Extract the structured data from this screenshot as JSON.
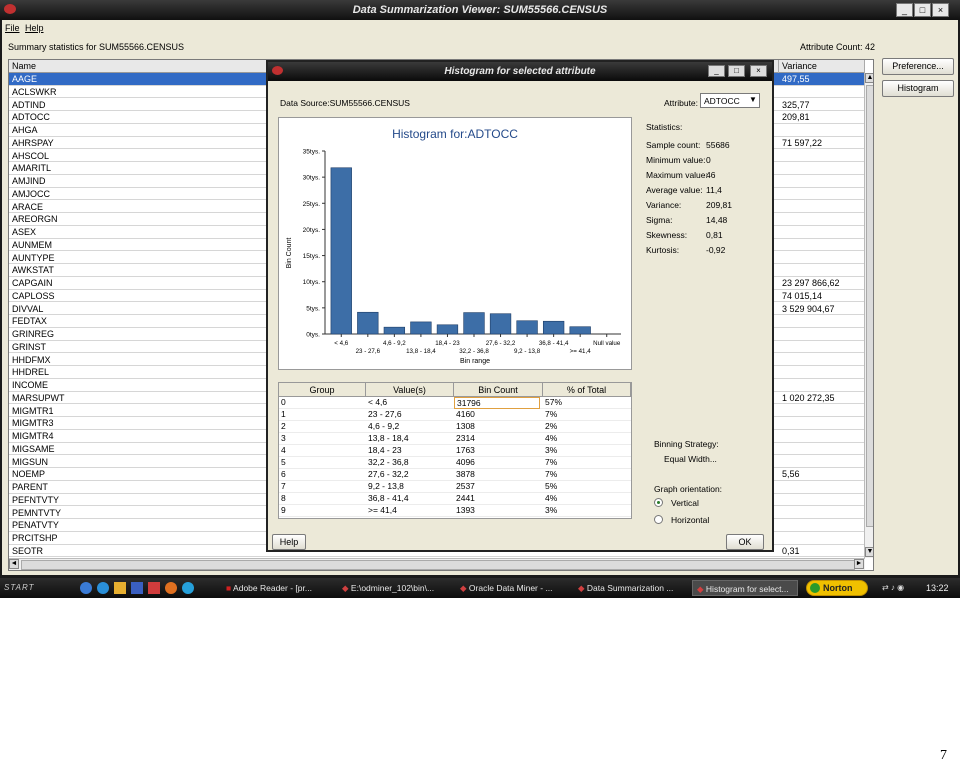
{
  "window": {
    "title": "Data Summarization Viewer: SUM55566.CENSUS",
    "menu": [
      "File",
      "Help"
    ],
    "summary_label": "Summary statistics for SUM55566.CENSUS",
    "attribute_count": "Attribute Count: 42",
    "buttons": {
      "preference": "Preference...",
      "histogram": "Histogram"
    }
  },
  "table": {
    "col_name": "Name",
    "col_variance": "Variance",
    "rows": [
      {
        "name": "AAGE",
        "variance": "497,55",
        "selected": true
      },
      {
        "name": "ACLSWKR",
        "variance": ""
      },
      {
        "name": "ADTIND",
        "variance": "325,77"
      },
      {
        "name": "ADTOCC",
        "variance": "209,81"
      },
      {
        "name": "AHGA",
        "variance": ""
      },
      {
        "name": "AHRSPAY",
        "variance": "71 597,22"
      },
      {
        "name": "AHSCOL",
        "variance": ""
      },
      {
        "name": "AMARITL",
        "variance": ""
      },
      {
        "name": "AMJIND",
        "variance": ""
      },
      {
        "name": "AMJOCC",
        "variance": ""
      },
      {
        "name": "ARACE",
        "variance": ""
      },
      {
        "name": "AREORGN",
        "variance": ""
      },
      {
        "name": "ASEX",
        "variance": ""
      },
      {
        "name": "AUNMEM",
        "variance": ""
      },
      {
        "name": "AUNTYPE",
        "variance": ""
      },
      {
        "name": "AWKSTAT",
        "variance": ""
      },
      {
        "name": "CAPGAIN",
        "variance": "23 297 866,62"
      },
      {
        "name": "CAPLOSS",
        "variance": "74 015,14"
      },
      {
        "name": "DIVVAL",
        "variance": "3 529 904,67"
      },
      {
        "name": "FEDTAX",
        "variance": ""
      },
      {
        "name": "GRINREG",
        "variance": ""
      },
      {
        "name": "GRINST",
        "variance": ""
      },
      {
        "name": "HHDFMX",
        "variance": ""
      },
      {
        "name": "HHDREL",
        "variance": ""
      },
      {
        "name": "INCOME",
        "variance": ""
      },
      {
        "name": "MARSUPWT",
        "variance": "1 020 272,35"
      },
      {
        "name": "MIGMTR1",
        "variance": ""
      },
      {
        "name": "MIGMTR3",
        "variance": ""
      },
      {
        "name": "MIGMTR4",
        "variance": ""
      },
      {
        "name": "MIGSAME",
        "variance": ""
      },
      {
        "name": "MIGSUN",
        "variance": ""
      },
      {
        "name": "NOEMP",
        "variance": "5,56"
      },
      {
        "name": "PARENT",
        "variance": ""
      },
      {
        "name": "PEFNTVTY",
        "variance": ""
      },
      {
        "name": "PEMNTVTY",
        "variance": ""
      },
      {
        "name": "PENATVTY",
        "variance": ""
      },
      {
        "name": "PRCITSHP",
        "variance": ""
      },
      {
        "name": "SEOTR",
        "variance": "0,31"
      }
    ]
  },
  "dialog": {
    "title": "Histogram for selected attribute",
    "data_source": "Data Source:SUM55566.CENSUS",
    "attribute_label": "Attribute:",
    "attribute_value": "ADTOCC",
    "statistics_title": "Statistics:",
    "stats": [
      {
        "label": "Sample count:",
        "value": "55686"
      },
      {
        "label": "Minimum value:",
        "value": "0"
      },
      {
        "label": "Maximum value:",
        "value": "46"
      },
      {
        "label": "Average value:",
        "value": "11,4"
      },
      {
        "label": "Variance:",
        "value": "209,81"
      },
      {
        "label": "Sigma:",
        "value": "14,48"
      },
      {
        "label": "Skewness:",
        "value": "0,81"
      },
      {
        "label": "Kurtosis:",
        "value": "-0,92"
      }
    ],
    "binning_label": "Binning Strategy:",
    "binning_value": "Equal Width...",
    "orientation_label": "Graph orientation:",
    "orientation_options": [
      "Vertical",
      "Horizontal"
    ],
    "orientation_selected": "Vertical",
    "help_button": "Help",
    "ok_button": "OK",
    "grid": {
      "headers": [
        "Group",
        "Value(s)",
        "Bin Count",
        "% of Total"
      ],
      "rows": [
        [
          "0",
          "< 4,6",
          "31796",
          "57%"
        ],
        [
          "1",
          "23 - 27,6",
          "4160",
          "7%"
        ],
        [
          "2",
          "4,6 - 9,2",
          "1308",
          "2%"
        ],
        [
          "3",
          "13,8 - 18,4",
          "2314",
          "4%"
        ],
        [
          "4",
          "18,4 - 23",
          "1763",
          "3%"
        ],
        [
          "5",
          "32,2 - 36,8",
          "4096",
          "7%"
        ],
        [
          "6",
          "27,6 - 32,2",
          "3878",
          "7%"
        ],
        [
          "7",
          "9,2 - 13,8",
          "2537",
          "5%"
        ],
        [
          "8",
          "36,8 - 41,4",
          "2441",
          "4%"
        ],
        [
          "9",
          ">= 41,4",
          "1393",
          "3%"
        ]
      ]
    }
  },
  "chart_data": {
    "type": "bar",
    "title": "Histogram for:ADTOCC",
    "xlabel": "Bin range",
    "ylabel": "Bin Count",
    "categories": [
      "< 4,6",
      "23 - 27,6",
      "4,6 - 9,2",
      "13,8 - 18,4",
      "18,4 - 23",
      "32,2 - 36,8",
      "27,6 - 32,2",
      "9,2 - 13,8",
      "36,8 - 41,4",
      ">= 41,4",
      "Null value"
    ],
    "values": [
      31796,
      4160,
      1308,
      2314,
      1763,
      4096,
      3878,
      2537,
      2441,
      1393,
      0
    ],
    "ylim": [
      0,
      35000
    ],
    "yticks": [
      "0tys.",
      "5tys.",
      "10tys.",
      "15tys.",
      "20tys.",
      "25tys.",
      "30tys.",
      "35tys."
    ],
    "bar_color": "#3d6ea7",
    "grid": false
  },
  "taskbar": {
    "start": "START",
    "tasks": [
      "Adobe Reader - [pr...",
      "E:\\odminer_102\\bin\\...",
      "Oracle Data Miner - ...",
      "Data Summarization ...",
      "Histogram for select..."
    ],
    "norton": "Norton",
    "clock": "13:22"
  },
  "page_number": "7"
}
